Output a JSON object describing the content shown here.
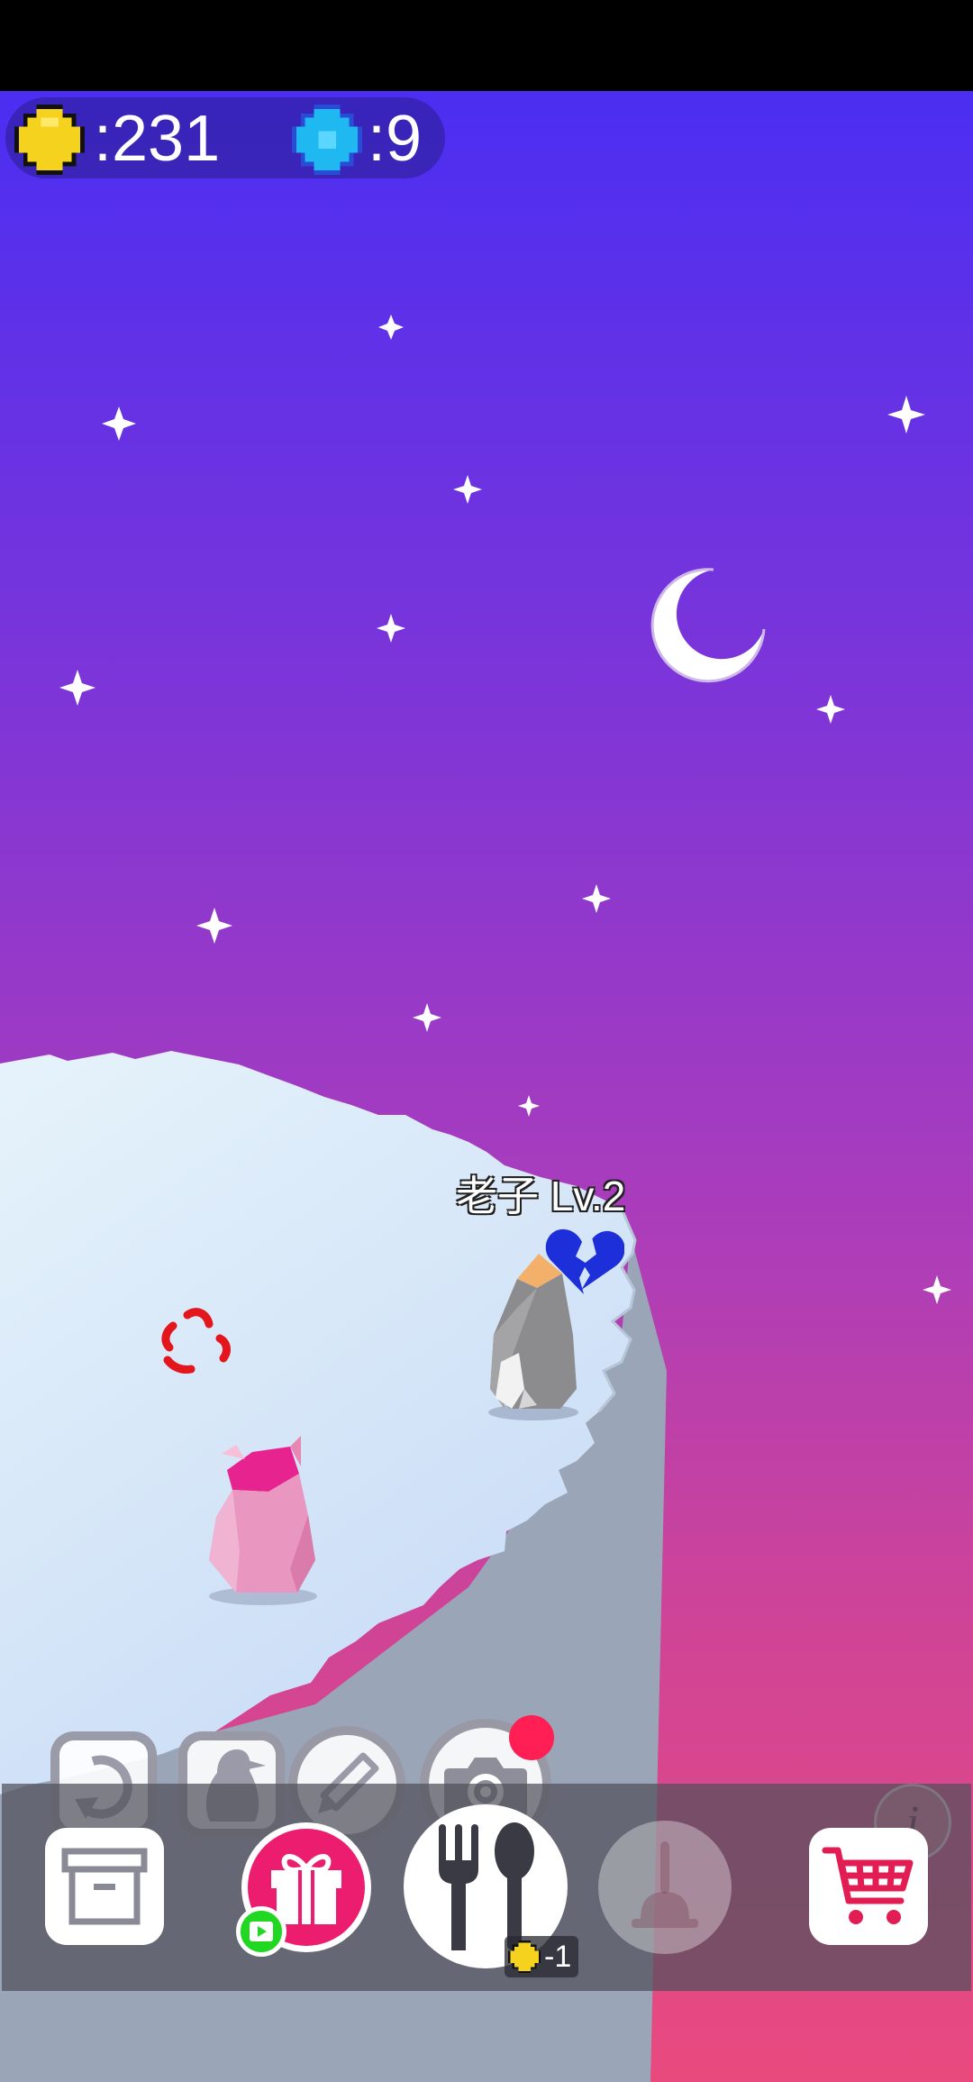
{
  "hud": {
    "coins": ":231",
    "gems": ":9"
  },
  "penguin": {
    "name_label": "老子  Lv.2"
  },
  "feed_cost": "-1",
  "icons": {
    "coin": "coin-icon",
    "gem": "gem-icon",
    "rotate": "rotate-icon",
    "penguin": "penguin-icon",
    "pencil": "pencil-icon",
    "camera": "camera-icon",
    "info": "info-icon",
    "box": "box-icon",
    "gift": "gift-icon",
    "video": "play-video-icon",
    "food": "fork-spoon-icon",
    "plunger": "plunger-icon",
    "cart": "cart-icon"
  },
  "colors": {
    "sky_top": "#4b2ef2",
    "sky_bottom": "#e94a7e",
    "gift": "#ec1d6e",
    "notification": "#ff1f55",
    "video_badge": "#22d722"
  }
}
